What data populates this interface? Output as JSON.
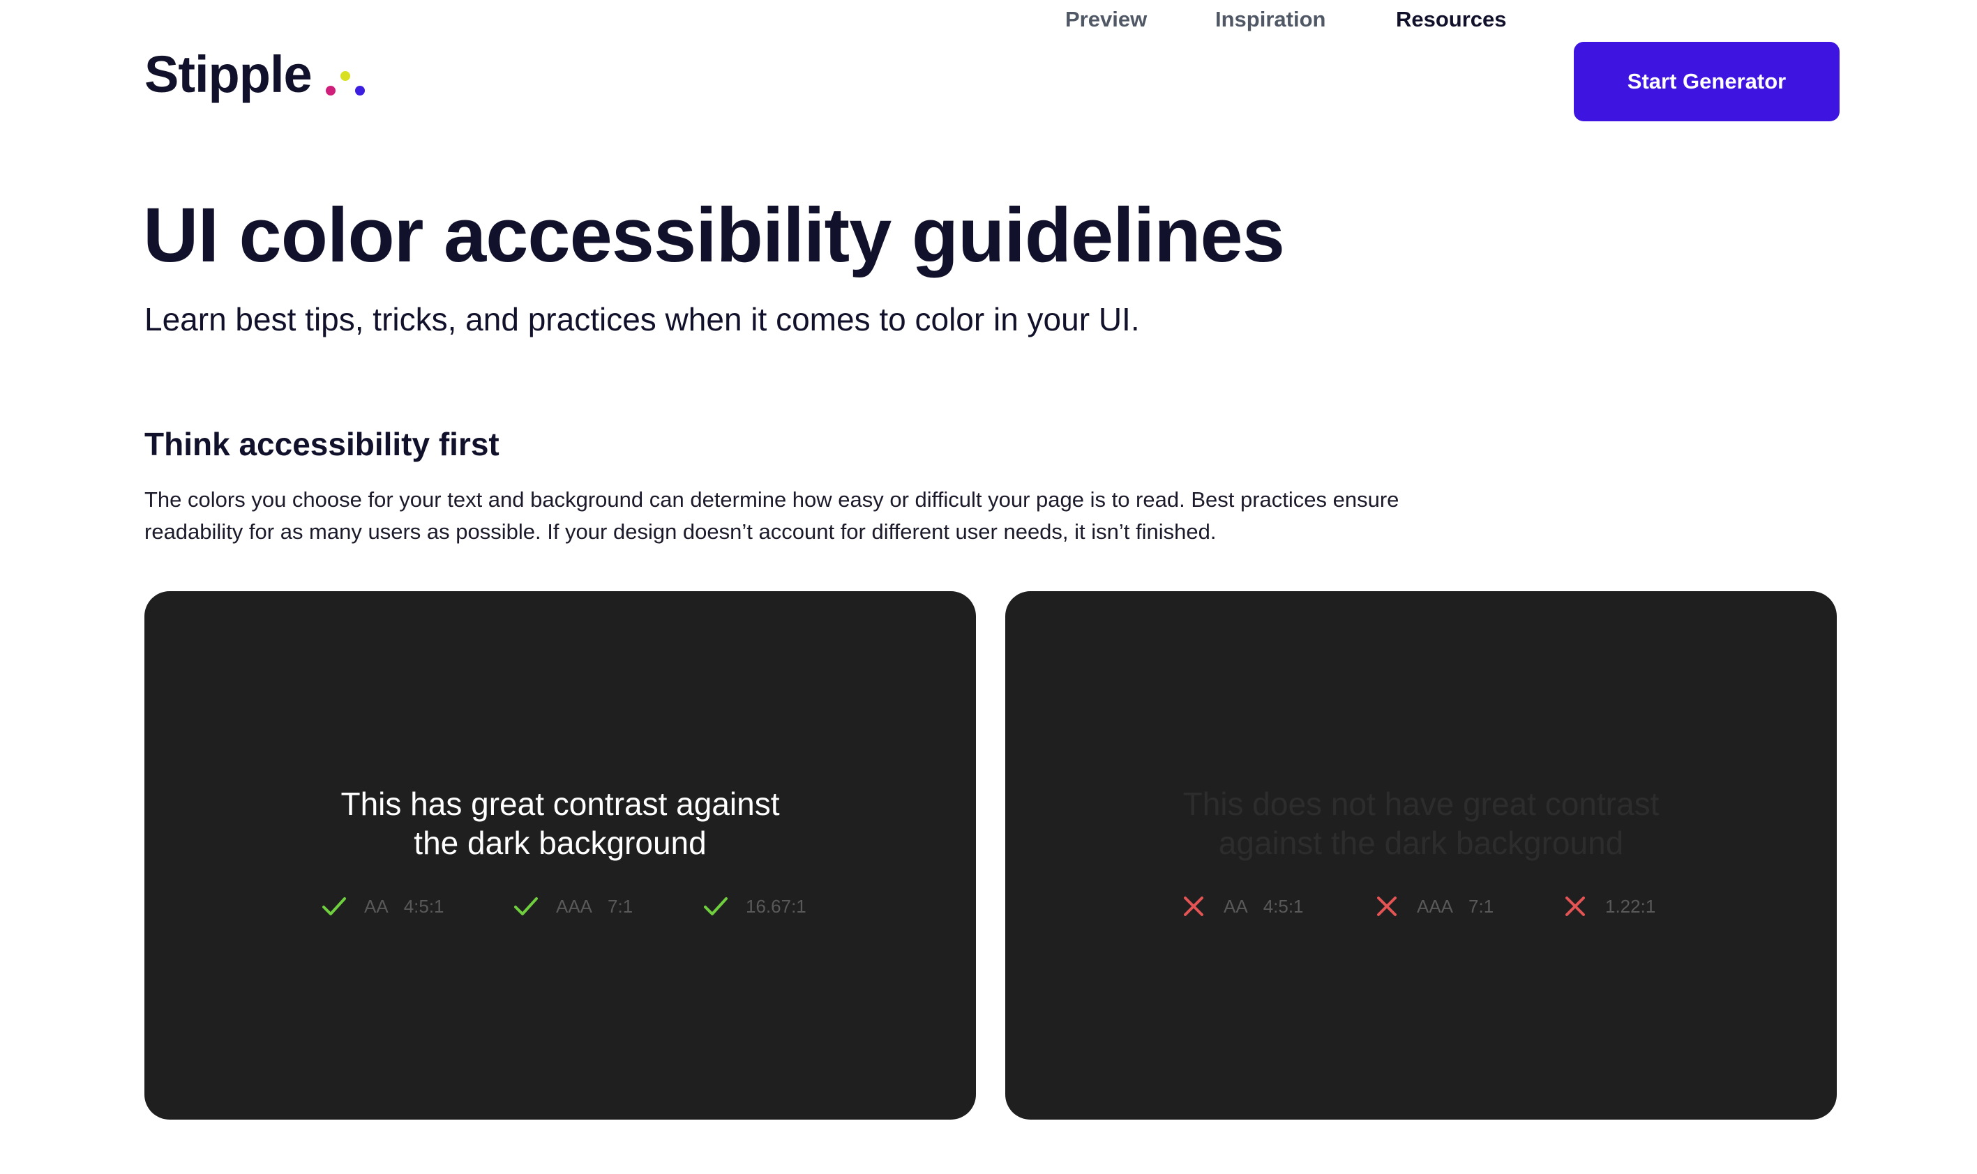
{
  "brand": {
    "name": "Stipple",
    "dot_colors": [
      "#d01f7a",
      "#d9e021",
      "#3b1ee0"
    ]
  },
  "nav": {
    "items": [
      {
        "label": "Preview"
      },
      {
        "label": "Inspiration"
      },
      {
        "label": "Resources",
        "active": true
      }
    ],
    "cta_label": "Start Generator",
    "cta_color": "#3d14e0"
  },
  "hero": {
    "title": "UI color accessibility guidelines",
    "subtitle": "Learn best tips, tricks, and practices when it comes to color in your UI."
  },
  "section": {
    "heading": "Think accessibility first",
    "body": "The colors you choose for your text and background can determine how easy or difficult your page is to read. Best practices ensure readability for as many users as possible. If your design doesn’t account for different user needs, it isn’t finished."
  },
  "cards": [
    {
      "text_line1": "This has great contrast against",
      "text_line2": "the dark background",
      "background": "#1f1f1f",
      "text_color": "#ffffff",
      "status_icon": "check-icon",
      "status_color": "#6fcf3f",
      "scores": [
        {
          "level": "AA",
          "ratio": "4:5:1"
        },
        {
          "level": "AAA",
          "ratio": "7:1"
        },
        {
          "level": "",
          "ratio": "16.67:1"
        }
      ]
    },
    {
      "text_line1": "This does not have great contrast",
      "text_line2": "against the dark background",
      "background": "#1f1f1f",
      "text_color": "#2d2d2d",
      "status_icon": "cross-icon",
      "status_color": "#e45454",
      "scores": [
        {
          "level": "AA",
          "ratio": "4:5:1"
        },
        {
          "level": "AAA",
          "ratio": "7:1"
        },
        {
          "level": "",
          "ratio": "1.22:1"
        }
      ]
    }
  ]
}
